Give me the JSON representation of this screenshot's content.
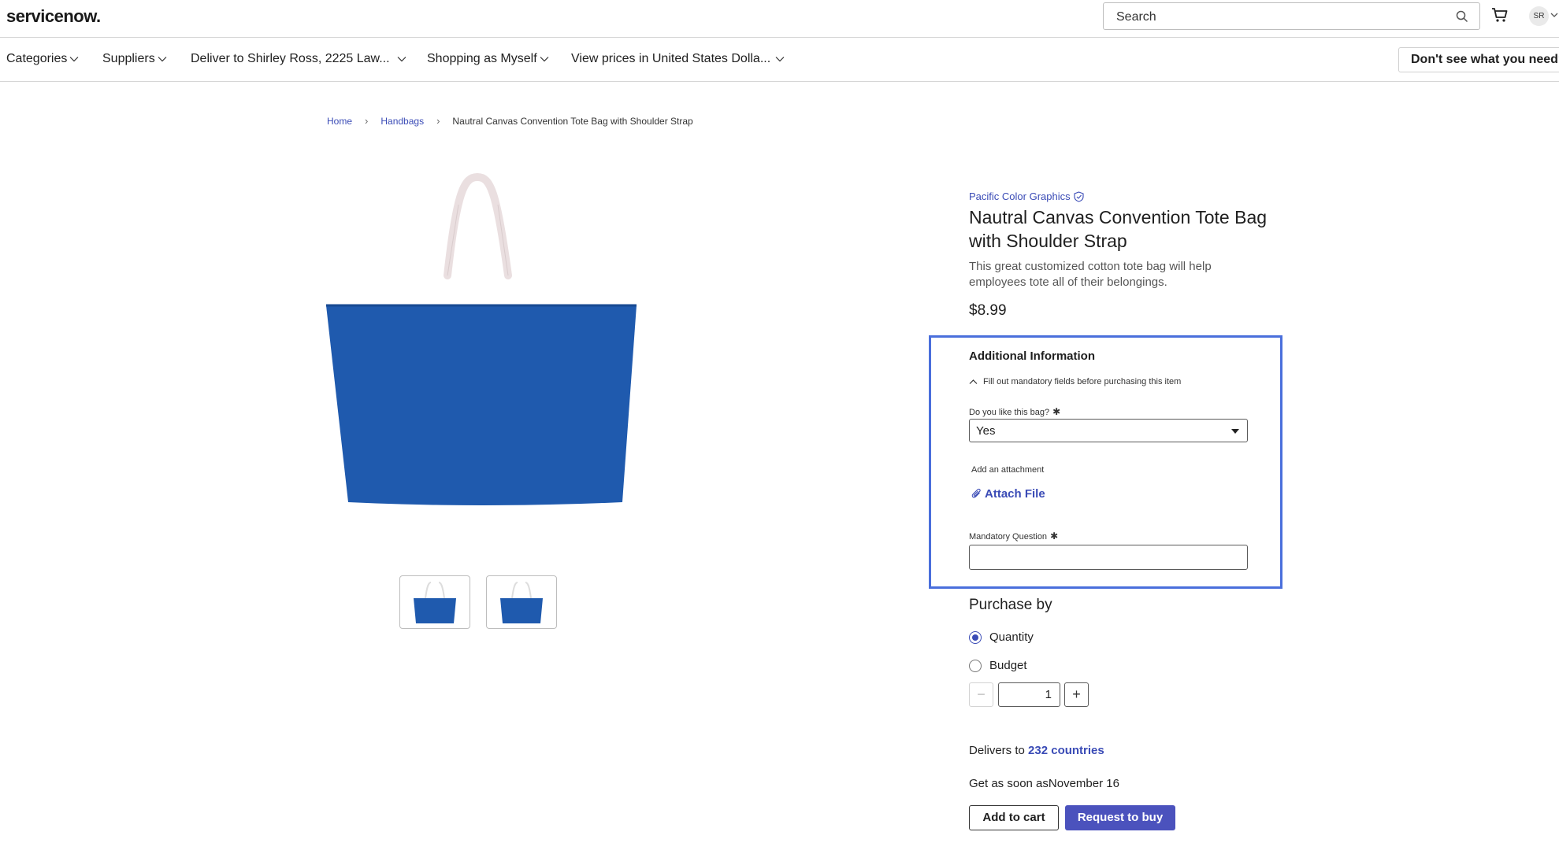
{
  "header": {
    "logo_text": "servicenow.",
    "search_placeholder": "Search",
    "avatar_initials": "SR"
  },
  "nav": {
    "items": [
      {
        "label": "Categories"
      },
      {
        "label": "Suppliers"
      },
      {
        "label": "Deliver to Shirley Ross, 2225 Law..."
      },
      {
        "label": "Shopping as Myself"
      },
      {
        "label": "View prices in United States Dolla..."
      }
    ],
    "help_button": "Don't see what you need?"
  },
  "breadcrumb": {
    "home": "Home",
    "category": "Handbags",
    "current": "Nautral Canvas Convention Tote Bag with Shoulder Strap"
  },
  "product": {
    "vendor": "Pacific Color Graphics",
    "title": "Nautral Canvas Convention Tote Bag with Shoulder Strap",
    "description": "This great customized cotton tote bag will help employees tote all of their belongings.",
    "price": "$8.99",
    "bag_color": "#1f5aae"
  },
  "additional_info": {
    "title": "Additional Information",
    "hint": "Fill out mandatory fields before purchasing this item",
    "q1_label": "Do you like this bag?",
    "q1_value": "Yes",
    "attachment_label": "Add an attachment",
    "attach_button": "Attach File",
    "q2_label": "Mandatory Question",
    "q2_value": "",
    "required_mark": "✱"
  },
  "purchase": {
    "heading": "Purchase by",
    "option_quantity": "Quantity",
    "option_budget": "Budget",
    "selected": "Quantity",
    "quantity": "1",
    "minus": "−",
    "plus": "+",
    "delivers_prefix": "Delivers to ",
    "delivers_link": "232 countries",
    "soon_text": "Get as soon asNovember 16",
    "add_to_cart": "Add to cart",
    "request_to_buy": "Request to buy"
  },
  "colors": {
    "accent": "#3a4bb6",
    "highlight_border": "#4a6fdc",
    "primary_button": "#4b52bd"
  }
}
